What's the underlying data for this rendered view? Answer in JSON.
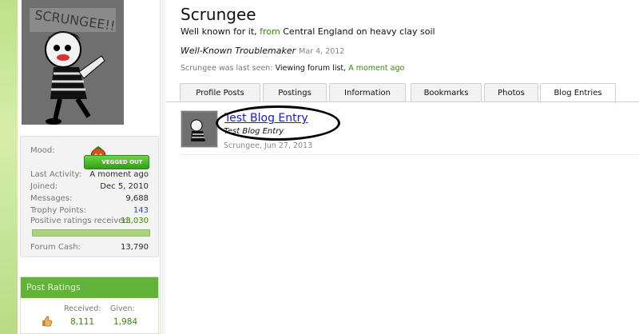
{
  "profile": {
    "name": "Scrungee",
    "subtitle_prefix": "Well known for it, ",
    "subtitle_from": "from",
    "subtitle_location": " Central England on heavy clay soil",
    "user_title": "Well-Known Troublemaker",
    "join_short": "Mar 4, 2012",
    "last_seen_label": "Scrungee was last seen:",
    "last_seen_activity": "Viewing forum list,",
    "last_seen_time": "A moment ago"
  },
  "sidebar": {
    "mood_label": "Mood:",
    "mood_badge": "VEGGED OUT",
    "stats": [
      {
        "label": "Last Activity:",
        "value": "A moment ago"
      },
      {
        "label": "Joined:",
        "value": "Dec 5, 2010"
      },
      {
        "label": "Messages:",
        "value": "9,688"
      },
      {
        "label": "Trophy Points:",
        "value": "143"
      },
      {
        "label": "Positive ratings received:",
        "value": "13,030"
      }
    ],
    "cash_label": "Forum Cash:",
    "cash_value": "13,790",
    "ratings": {
      "title": "Post Ratings",
      "received_label": "Received:",
      "given_label": "Given:",
      "received": "8,111",
      "given": "1,984"
    }
  },
  "tabs": [
    {
      "label": "Profile Posts",
      "active": false
    },
    {
      "label": "Postings",
      "active": false
    },
    {
      "label": "Information",
      "active": false
    },
    {
      "label": "Bookmarks",
      "active": false
    },
    {
      "label": "Photos",
      "active": false
    },
    {
      "label": "Blog Entries",
      "active": true
    }
  ],
  "blog_entry": {
    "title": "Test Blog Entry",
    "description": "Test Blog Entry",
    "author": "Scrungee",
    "date": "Jun 27, 2013"
  },
  "colors": {
    "accent_green": "#3b8b00",
    "header_green": "#61b33a",
    "link_blue": "#1a1ad0"
  }
}
